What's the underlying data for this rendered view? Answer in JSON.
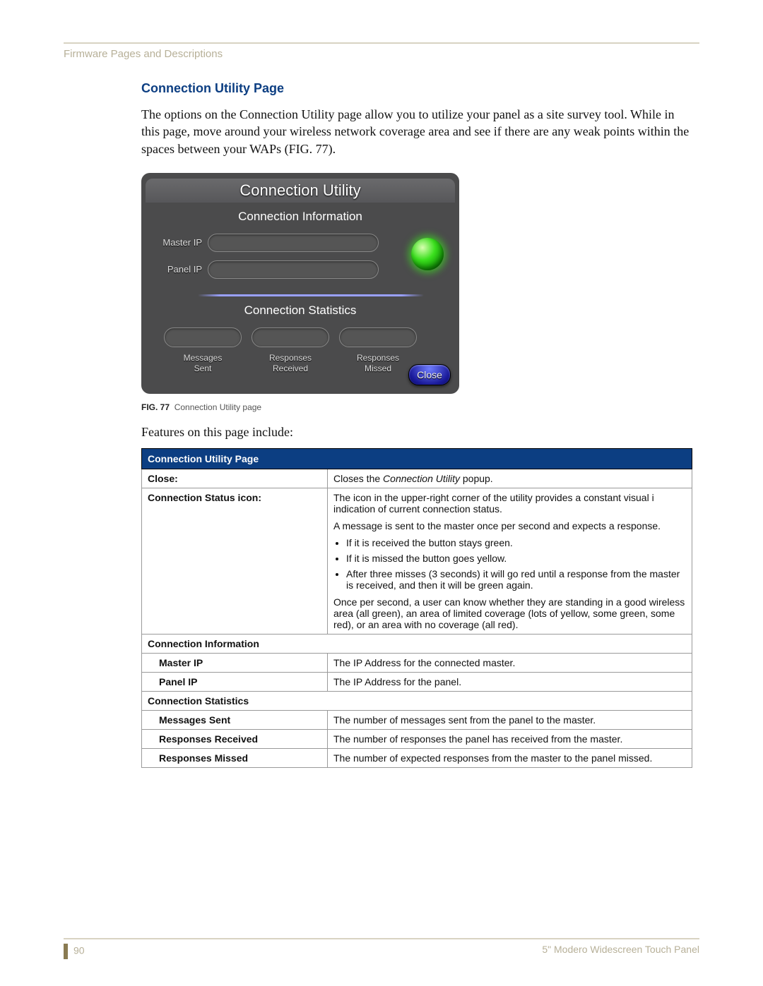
{
  "header": {
    "crumb": "Firmware Pages and Descriptions"
  },
  "section": {
    "title": "Connection Utility Page",
    "intro": "The options on the Connection Utility page allow you to utilize your panel as a site survey tool. While in this page, move around your wireless network coverage area and see if there are any weak points within the spaces between your WAPs (FIG. 77).",
    "features_line": "Features on this page include:"
  },
  "panel": {
    "title": "Connection Utility",
    "info_heading": "Connection Information",
    "master_label": "Master IP",
    "panel_label": "Panel IP",
    "stats_heading": "Connection Statistics",
    "stats": {
      "messages_sent": "Messages\nSent",
      "responses_received": "Responses\nReceived",
      "responses_missed": "Responses\nMissed"
    },
    "close_label": "Close"
  },
  "figure": {
    "num": "FIG. 77",
    "caption": "Connection Utility page"
  },
  "table": {
    "header": "Connection Utility Page",
    "rows": {
      "close": {
        "label": "Close:",
        "desc_prefix": "Closes the ",
        "desc_italic": "Connection Utility",
        "desc_suffix": " popup."
      },
      "status_icon": {
        "label": "Connection Status icon:",
        "p1": "The icon in the upper-right corner of the utility provides a constant visual i indication of current connection status.",
        "p2": "A message is sent to the master once per second and expects a response.",
        "b1": "If it is received the button stays green.",
        "b2": "If it is missed the button goes yellow.",
        "b3": "After three misses (3 seconds) it will go red until a response from the master is received, and then it will be green again.",
        "p3": "Once per second, a user can know whether they are standing in a good wireless area (all green), an area of limited coverage (lots of yellow, some green, some red), or an area with no coverage (all red)."
      },
      "conn_info": {
        "label": "Connection Information"
      },
      "master_ip": {
        "label": "Master IP",
        "desc": "The IP Address for the connected master."
      },
      "panel_ip": {
        "label": "Panel IP",
        "desc": "The IP Address for the panel."
      },
      "conn_stats": {
        "label": "Connection Statistics"
      },
      "messages_sent": {
        "label": "Messages Sent",
        "desc": "The number of messages sent from the panel to the master."
      },
      "responses_received": {
        "label": "Responses Received",
        "desc": "The number of responses the panel has received from the master."
      },
      "responses_missed": {
        "label": "Responses Missed",
        "desc": "The number of expected responses from the master to the panel missed."
      }
    }
  },
  "footer": {
    "page_number": "90",
    "doc_title": "5\" Modero Widescreen Touch Panel"
  }
}
